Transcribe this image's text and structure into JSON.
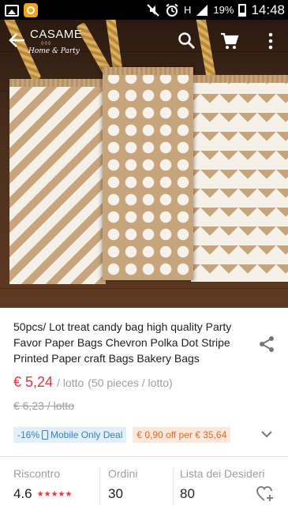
{
  "status_bar": {
    "icons": [
      "gallery-icon",
      "aliexpress-notification-icon",
      "mute-icon",
      "alarm-icon",
      "hspa-icon",
      "signal-icon",
      "battery-icon"
    ],
    "network": "H",
    "battery": "19%",
    "time": "14:48"
  },
  "app_bar": {
    "logo_name": "CASAME",
    "logo_tagline": "Home & Party",
    "logo_ornament": "◊◊◊"
  },
  "product": {
    "title": "50pcs/ Lot  treat candy bag high quality Party Favor Paper Bags Chevron Polka Dot Stripe Printed Paper craft Bags Bakery Bags",
    "price": "€ 5,24",
    "unit": "/ lotto",
    "pieces": "(50 pieces / lotto)",
    "old_price": "€ 6,23 / lotto"
  },
  "promotions": {
    "discount": "-16%",
    "mobile_deal": "Mobile Only Deal",
    "coupon": "€ 0,90 off per € 35,64"
  },
  "stats": {
    "feedback_label": "Riscontro",
    "feedback_value": "4.6",
    "feedback_stars": "★★★★★",
    "orders_label": "Ordini",
    "orders_value": "30",
    "wishlist_label": "Lista dei Desideri",
    "wishlist_value": "80"
  },
  "colors": {
    "price": "#e4393c",
    "mobile_tag_bg": "#e3f0fb",
    "mobile_tag_text": "#3a7fc8",
    "coupon_bg": "#fde9dc",
    "coupon_text": "#f06423"
  }
}
